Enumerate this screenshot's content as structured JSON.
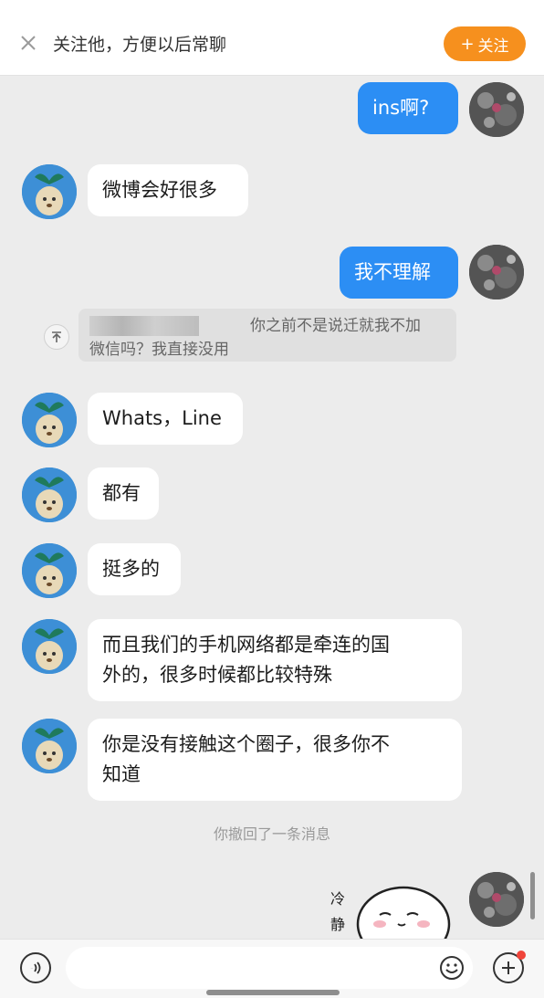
{
  "topbar": {
    "tip": "关注他，方便以后常聊",
    "follow_label": "关注",
    "follow_plus": "+"
  },
  "messages": {
    "m1": "ins啊?",
    "m2": "微博会好很多",
    "m3": "我不理解",
    "m4": "Whats，Line",
    "m5": "都有",
    "m6": "挺多的",
    "m7_line1": "而且我们的手机网络都是牵连的国",
    "m7_line2": "外的，很多时候都比较特殊",
    "m8_line1": "你是没有接触这个圈子，很多你不",
    "m8_line2": "知道"
  },
  "quote": {
    "line1": "你之前不是说迁就我不加",
    "line2": "微信吗？我直接没用"
  },
  "recall_notice": "你撤回了一条消息",
  "sticker": {
    "text_1": "冷",
    "text_2": "静"
  },
  "input": {
    "placeholder": ""
  },
  "colors": {
    "accent": "#f6901e",
    "bubble_self": "#2c8ef4",
    "badge": "#f0443a"
  }
}
